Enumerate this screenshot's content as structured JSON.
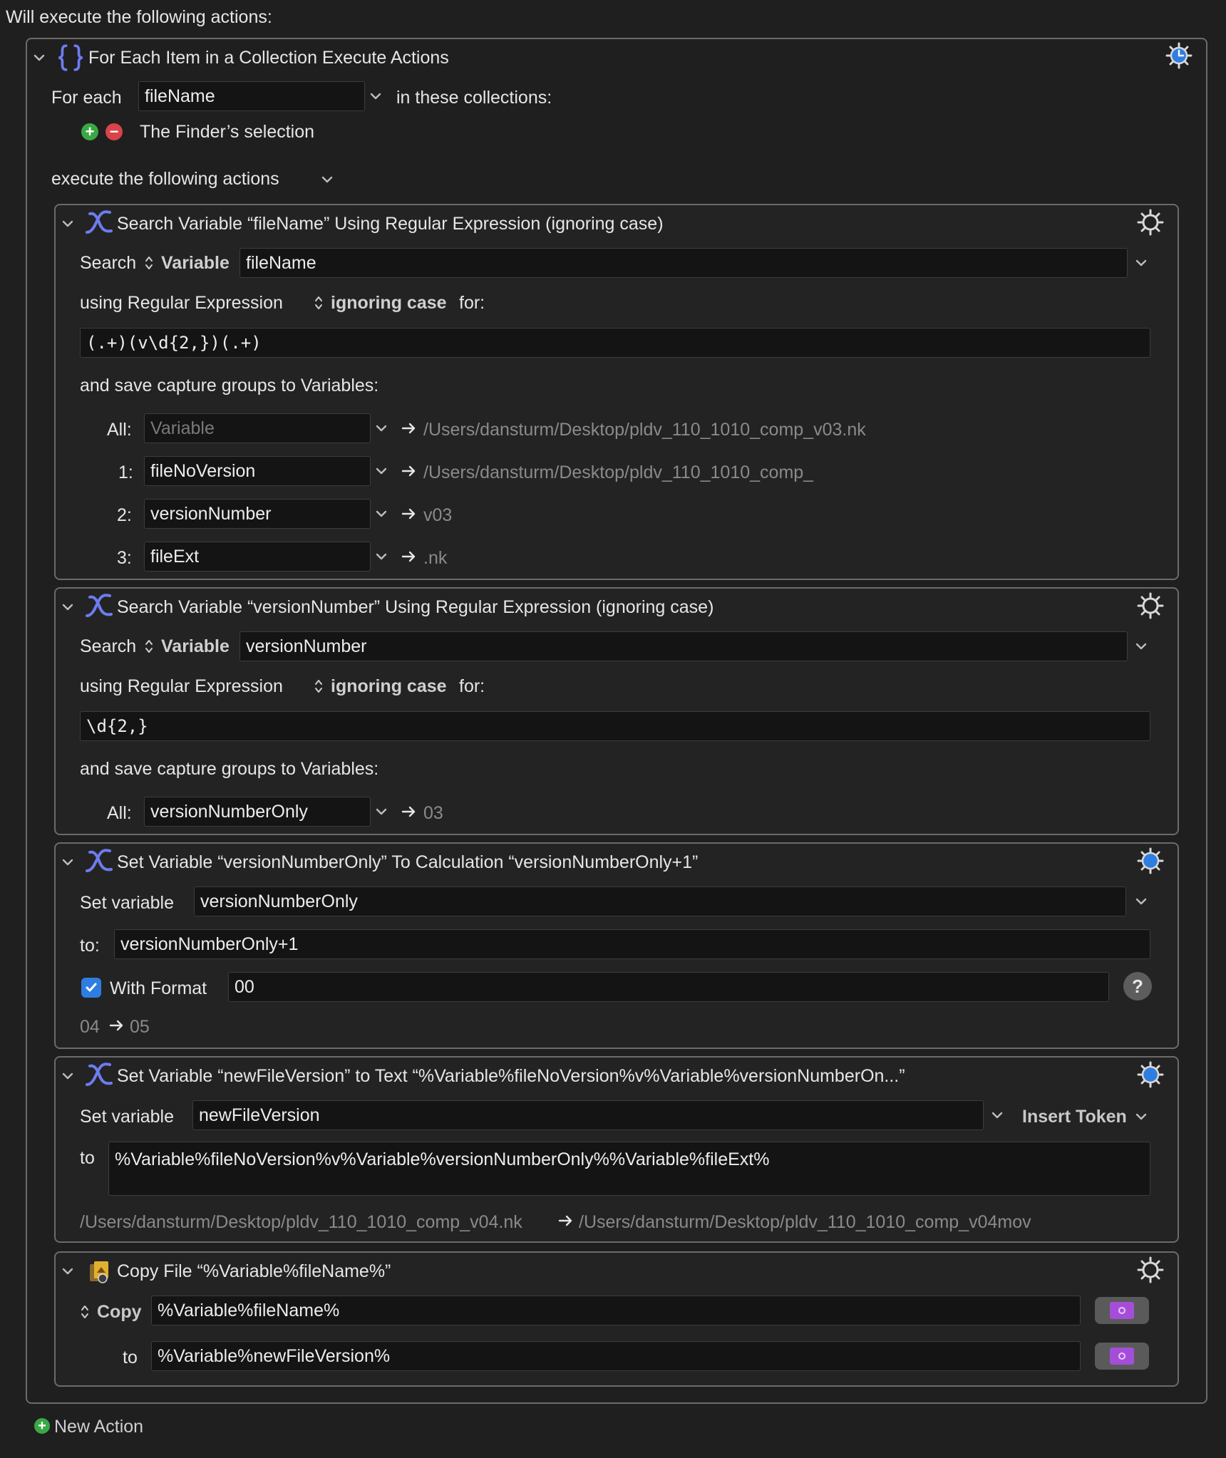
{
  "header": "Will execute the following actions:",
  "for_each": {
    "title": "For Each Item in a Collection Execute Actions",
    "label_for_each": "For each",
    "variable": "fileName",
    "label_in": "in these collections:",
    "collection": "The Finder’s selection",
    "label_execute": "execute the following actions"
  },
  "search1": {
    "title": "Search Variable “fileName” Using Regular Expression (ignoring case)",
    "label_search": "Search",
    "label_variable": "Variable",
    "variable": "fileName",
    "label_using": "using Regular Expression",
    "label_case": "ignoring case",
    "label_for": "for:",
    "regex": "(.+)(v\\d{2,})(.+)",
    "label_save": "and save capture groups to Variables:",
    "groups": [
      {
        "label": "All:",
        "var": "",
        "placeholder": "Variable",
        "result": "/Users/dansturm/Desktop/pldv_110_1010_comp_v03.nk"
      },
      {
        "label": "1:",
        "var": "fileNoVersion",
        "placeholder": "",
        "result": "/Users/dansturm/Desktop/pldv_110_1010_comp_"
      },
      {
        "label": "2:",
        "var": "versionNumber",
        "placeholder": "",
        "result": "v03"
      },
      {
        "label": "3:",
        "var": "fileExt",
        "placeholder": "",
        "result": ".nk"
      }
    ]
  },
  "search2": {
    "title": "Search Variable “versionNumber” Using Regular Expression (ignoring case)",
    "label_search": "Search",
    "label_variable": "Variable",
    "variable": "versionNumber",
    "label_using": "using Regular Expression",
    "label_case": "ignoring case",
    "label_for": "for:",
    "regex": "\\d{2,}",
    "label_save": "and save capture groups to Variables:",
    "groups": [
      {
        "label": "All:",
        "var": "versionNumberOnly",
        "result": "03"
      }
    ]
  },
  "setcalc": {
    "title": "Set Variable “versionNumberOnly” To Calculation “versionNumberOnly+1”",
    "label_set": "Set variable",
    "variable": "versionNumberOnly",
    "label_to": "to:",
    "calculation": "versionNumberOnly+1",
    "with_format_checked": true,
    "label_format": "With Format",
    "format": "00",
    "preview_from": "04",
    "preview_to": "05"
  },
  "settext": {
    "title": "Set Variable “newFileVersion” to Text “%Variable%fileNoVersion%v%Variable%versionNumberOn...”",
    "label_set": "Set variable",
    "variable": "newFileVersion",
    "insert_token": "Insert Token",
    "label_to": "to",
    "text": "%Variable%fileNoVersion%v%Variable%versionNumberOnly%%Variable%fileExt%",
    "preview_from": "/Users/dansturm/Desktop/pldv_110_1010_comp_v04.nk",
    "preview_to": "/Users/dansturm/Desktop/pldv_110_1010_comp_v04mov"
  },
  "copyfile": {
    "title": "Copy File “%Variable%fileName%”",
    "label_copy": "Copy",
    "source": "%Variable%fileName%",
    "label_to": "to",
    "destination": "%Variable%newFileVersion%"
  },
  "footer": {
    "new_action": "New Action"
  },
  "colors": {
    "background": "#1f1f1f",
    "field": "#141414",
    "accent_blue": "#2f7de1",
    "add_green": "#3aa845",
    "remove_red": "#d9434a",
    "purple": "#a44ed8"
  }
}
